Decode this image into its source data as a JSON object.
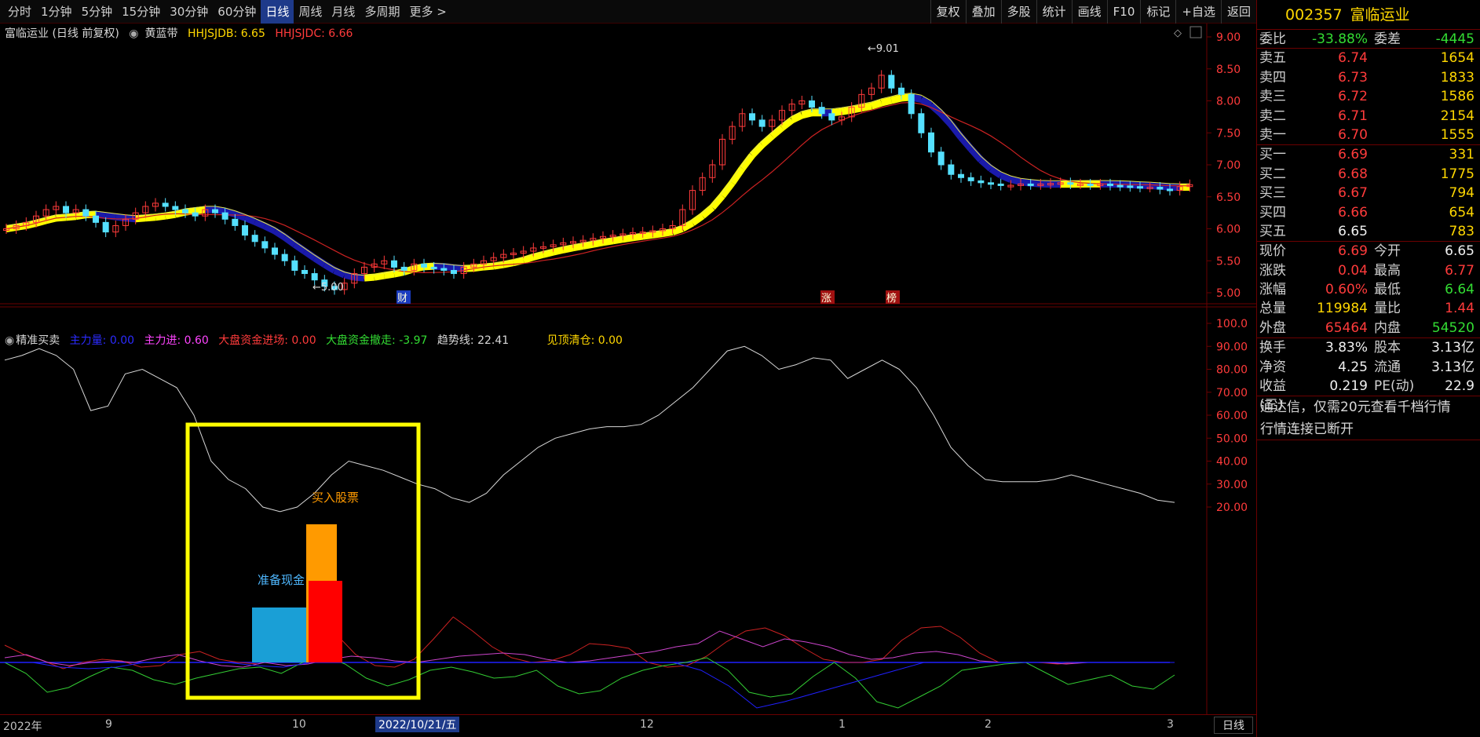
{
  "toolbar": {
    "periods": [
      "分时",
      "1分钟",
      "5分钟",
      "15分钟",
      "30分钟",
      "60分钟",
      "日线",
      "周线",
      "月线",
      "多周期",
      "更多 >"
    ],
    "active_period": "日线",
    "right_buttons": [
      "复权",
      "叠加",
      "多股",
      "统计",
      "画线",
      "F10",
      "标记",
      "+自选",
      "返回"
    ]
  },
  "main_chart": {
    "title": "富临运业 (日线 前复权)",
    "indicator": "黄蓝带",
    "hhjsjdb": "HHJSJDB: 6.65",
    "hhjsjdc": "HHJSJDC: 6.66",
    "y_ticks": [
      "9.00",
      "8.50",
      "8.00",
      "7.50",
      "7.00",
      "6.50",
      "6.00",
      "5.50",
      "5.00"
    ],
    "high_label": "9.01",
    "low_label": "5.00",
    "markers": [
      "财",
      "涨",
      "榜"
    ]
  },
  "sub_chart": {
    "indicator": "精准买卖",
    "zlsl": "主力量: 0.00",
    "zlj": "主力进: 0.60",
    "dpjc": "大盘资金进场: 0.00",
    "dpcz": "大盘资金撤走: -3.97",
    "qsx": "趋势线: 22.41",
    "jdqc": "见顶清仓: 0.00",
    "y_ticks": [
      "100.0",
      "90.00",
      "80.00",
      "70.00",
      "60.00",
      "50.00",
      "40.00",
      "30.00",
      "20.00"
    ],
    "annotation_buy": "买入股票",
    "annotation_cash": "准备现金"
  },
  "date_axis": {
    "labels": [
      "2022年",
      "9",
      "10",
      "12",
      "1",
      "2",
      "3"
    ],
    "cursor": "2022/10/21/五",
    "period_button": "日线"
  },
  "quote": {
    "code": "002357",
    "name": "富临运业",
    "weibi_label": "委比",
    "weibi": "-33.88%",
    "weicha_label": "委差",
    "weicha": "-4445",
    "asks": [
      {
        "label": "卖五",
        "price": "6.74",
        "vol": "1654"
      },
      {
        "label": "卖四",
        "price": "6.73",
        "vol": "1833"
      },
      {
        "label": "卖三",
        "price": "6.72",
        "vol": "1586"
      },
      {
        "label": "卖二",
        "price": "6.71",
        "vol": "2154"
      },
      {
        "label": "卖一",
        "price": "6.70",
        "vol": "1555"
      }
    ],
    "bids": [
      {
        "label": "买一",
        "price": "6.69",
        "vol": "331"
      },
      {
        "label": "买二",
        "price": "6.68",
        "vol": "1775"
      },
      {
        "label": "买三",
        "price": "6.67",
        "vol": "794"
      },
      {
        "label": "买四",
        "price": "6.66",
        "vol": "654"
      },
      {
        "label": "买五",
        "price": "6.65",
        "vol": "783"
      }
    ],
    "stats": [
      {
        "l1": "现价",
        "v1": "6.69",
        "l2": "今开",
        "v2": "6.65"
      },
      {
        "l1": "涨跌",
        "v1": "0.04",
        "l2": "最高",
        "v2": "6.77"
      },
      {
        "l1": "涨幅",
        "v1": "0.60%",
        "l2": "最低",
        "v2": "6.64"
      },
      {
        "l1": "总量",
        "v1": "119984",
        "l2": "量比",
        "v2": "1.44"
      },
      {
        "l1": "外盘",
        "v1": "65464",
        "l2": "内盘",
        "v2": "54520"
      }
    ],
    "fund": [
      {
        "l1": "换手",
        "v1": "3.83%",
        "l2": "股本",
        "v2": "3.13亿"
      },
      {
        "l1": "净资",
        "v1": "4.25",
        "l2": "流通",
        "v2": "3.13亿"
      },
      {
        "l1": "收益(三)",
        "v1": "0.219",
        "l2": "PE(动)",
        "v2": "22.9"
      }
    ],
    "message1": "通达信，仅需20元查看千档行情",
    "message2": "行情连接已断开"
  },
  "colors": {
    "up": "#ff3b3b",
    "down": "#55e0ff",
    "yellow_band": "#ffff00",
    "blue_band": "#1a1aaa",
    "frame": "#ffff00",
    "grid_red": "#6b0000"
  }
}
